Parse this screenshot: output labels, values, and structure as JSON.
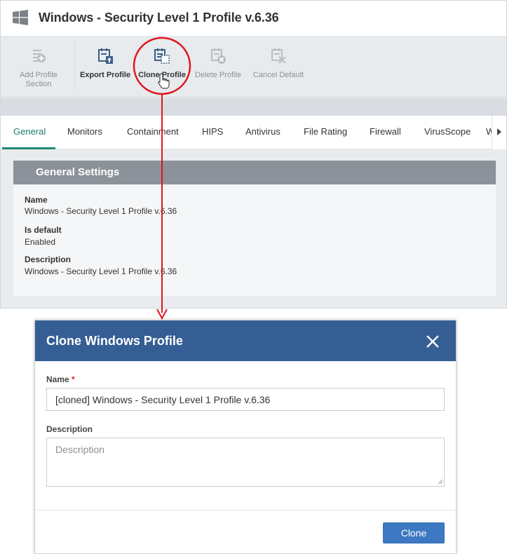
{
  "profile": {
    "title": "Windows - Security Level 1 Profile v.6.36",
    "logo_icon": "windows-logo-icon"
  },
  "toolbar": {
    "items": [
      {
        "label_line1": "Add Profile",
        "label_line2": "Section",
        "icon": "add-section-icon",
        "state": "disabled"
      },
      {
        "label_line1": "Export Profile",
        "label_line2": "",
        "icon": "export-icon",
        "state": "enabled"
      },
      {
        "label_line1": "Clone Profile",
        "label_line2": "",
        "icon": "clone-icon",
        "state": "enabled"
      },
      {
        "label_line1": "Delete Profile",
        "label_line2": "",
        "icon": "delete-icon",
        "state": "disabled"
      },
      {
        "label_line1": "Cancel Default",
        "label_line2": "",
        "icon": "cancel-default-icon",
        "state": "disabled"
      }
    ]
  },
  "tabs": {
    "items": [
      "General",
      "Monitors",
      "Containment",
      "HIPS",
      "Antivirus",
      "File Rating",
      "Firewall",
      "VirusScope",
      "W"
    ],
    "selected": "General"
  },
  "general_settings": {
    "header": "General Settings",
    "fields": [
      {
        "label": "Name",
        "value": "Windows - Security Level 1 Profile v.6.36"
      },
      {
        "label": "Is default",
        "value": "Enabled"
      },
      {
        "label": "Description",
        "value": "Windows - Security Level 1 Profile v.6.36"
      }
    ]
  },
  "clone_dialog": {
    "title": "Clone Windows Profile",
    "name_label": "Name",
    "required_marker": "*",
    "name_value": "[cloned] Windows - Security Level 1 Profile v.6.36",
    "description_label": "Description",
    "description_placeholder": "Description",
    "clone_button": "Clone",
    "close_icon": "close-icon"
  },
  "colors": {
    "accent_teal": "#1e7e6b",
    "dialog_header": "#355e94",
    "primary_button": "#3d78c2",
    "annotation_red": "#e0161e",
    "settings_header": "#8b9299"
  }
}
